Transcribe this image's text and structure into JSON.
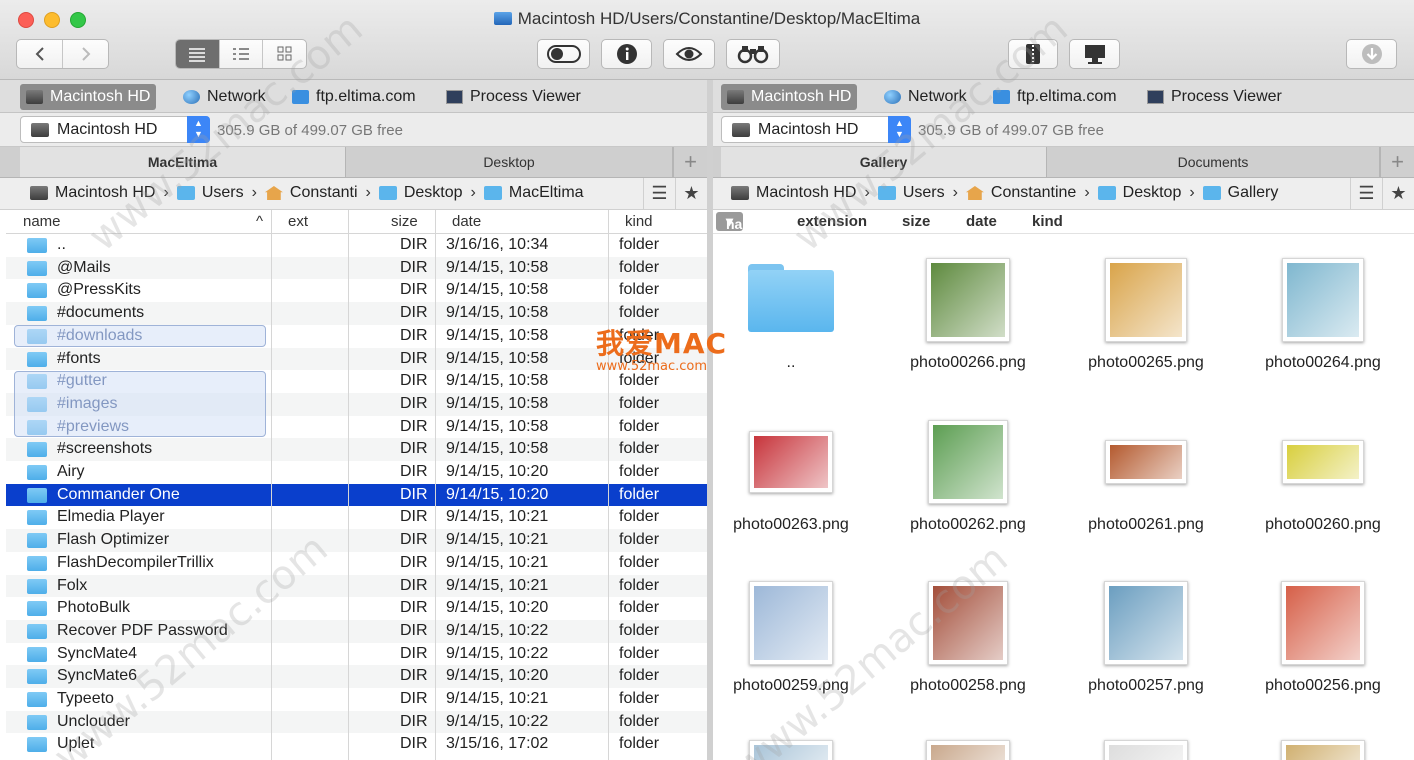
{
  "window": {
    "title": "Macintosh HD/Users/Constantine/Desktop/MacEltima"
  },
  "favorites": [
    "Macintosh HD",
    "Network",
    "ftp.eltima.com",
    "Process Viewer"
  ],
  "drive": {
    "name": "Macintosh HD",
    "free": "305.9 GB of 499.07 GB free"
  },
  "left": {
    "tabs": [
      "MacEltima",
      "Desktop"
    ],
    "path": [
      "Macintosh HD",
      "Users",
      "Constanti",
      "Desktop",
      "MacEltima"
    ],
    "columns": {
      "name": "name",
      "ext": "ext",
      "size": "size",
      "date": "date",
      "kind": "kind"
    },
    "rows": [
      {
        "name": "..",
        "size": "DIR",
        "date": "3/16/16, 10:34",
        "kind": "folder"
      },
      {
        "name": "@Mails",
        "size": "DIR",
        "date": "9/14/15, 10:58",
        "kind": "folder"
      },
      {
        "name": "@PressKits",
        "size": "DIR",
        "date": "9/14/15, 10:58",
        "kind": "folder"
      },
      {
        "name": "#documents",
        "size": "DIR",
        "date": "9/14/15, 10:58",
        "kind": "folder"
      },
      {
        "name": "#downloads",
        "size": "DIR",
        "date": "9/14/15, 10:58",
        "kind": "folder"
      },
      {
        "name": "#fonts",
        "size": "DIR",
        "date": "9/14/15, 10:58",
        "kind": "folder"
      },
      {
        "name": "#gutter",
        "size": "DIR",
        "date": "9/14/15, 10:58",
        "kind": "folder"
      },
      {
        "name": "#images",
        "size": "DIR",
        "date": "9/14/15, 10:58",
        "kind": "folder"
      },
      {
        "name": "#previews",
        "size": "DIR",
        "date": "9/14/15, 10:58",
        "kind": "folder"
      },
      {
        "name": "#screenshots",
        "size": "DIR",
        "date": "9/14/15, 10:58",
        "kind": "folder"
      },
      {
        "name": "Airy",
        "size": "DIR",
        "date": "9/14/15, 10:20",
        "kind": "folder"
      },
      {
        "name": "Commander One",
        "size": "DIR",
        "date": "9/14/15, 10:20",
        "kind": "folder"
      },
      {
        "name": "Elmedia Player",
        "size": "DIR",
        "date": "9/14/15, 10:21",
        "kind": "folder"
      },
      {
        "name": "Flash Optimizer",
        "size": "DIR",
        "date": "9/14/15, 10:21",
        "kind": "folder"
      },
      {
        "name": "FlashDecompilerTrillix",
        "size": "DIR",
        "date": "9/14/15, 10:21",
        "kind": "folder"
      },
      {
        "name": "Folx",
        "size": "DIR",
        "date": "9/14/15, 10:21",
        "kind": "folder"
      },
      {
        "name": "PhotoBulk",
        "size": "DIR",
        "date": "9/14/15, 10:20",
        "kind": "folder"
      },
      {
        "name": "Recover PDF Password",
        "size": "DIR",
        "date": "9/14/15, 10:22",
        "kind": "folder"
      },
      {
        "name": "SyncMate4",
        "size": "DIR",
        "date": "9/14/15, 10:22",
        "kind": "folder"
      },
      {
        "name": "SyncMate6",
        "size": "DIR",
        "date": "9/14/15, 10:20",
        "kind": "folder"
      },
      {
        "name": "Typeeto",
        "size": "DIR",
        "date": "9/14/15, 10:21",
        "kind": "folder"
      },
      {
        "name": "Unclouder",
        "size": "DIR",
        "date": "9/14/15, 10:22",
        "kind": "folder"
      },
      {
        "name": "Uplet",
        "size": "DIR",
        "date": "3/15/16, 17:02",
        "kind": "folder"
      }
    ]
  },
  "right": {
    "tabs": [
      "Gallery",
      "Documents"
    ],
    "path": [
      "Macintosh HD",
      "Users",
      "Constantine",
      "Desktop",
      "Gallery"
    ],
    "columns": {
      "name": "name",
      "extension": "extension",
      "size": "size",
      "date": "date",
      "kind": "kind"
    },
    "items": [
      {
        "label": "..",
        "type": "folder"
      },
      {
        "label": "photo00266.png",
        "color": "#5e8a3e"
      },
      {
        "label": "photo00265.png",
        "color": "#d9a44a"
      },
      {
        "label": "photo00264.png",
        "color": "#7fb7cf"
      },
      {
        "label": "photo00263.png",
        "color": "#c7343b"
      },
      {
        "label": "photo00262.png",
        "color": "#5c9e52"
      },
      {
        "label": "photo00261.png",
        "color": "#b45a2f"
      },
      {
        "label": "photo00260.png",
        "color": "#d8cf3e"
      },
      {
        "label": "photo00259.png",
        "color": "#9db8d8"
      },
      {
        "label": "photo00258.png",
        "color": "#a34e3a"
      },
      {
        "label": "photo00257.png",
        "color": "#6b9ec0"
      },
      {
        "label": "photo00256.png",
        "color": "#d65f48"
      }
    ]
  },
  "watermark": {
    "site": "www.52mac.com",
    "logo": "我爱MAC",
    "logo_sub": "www.52mac.com"
  }
}
